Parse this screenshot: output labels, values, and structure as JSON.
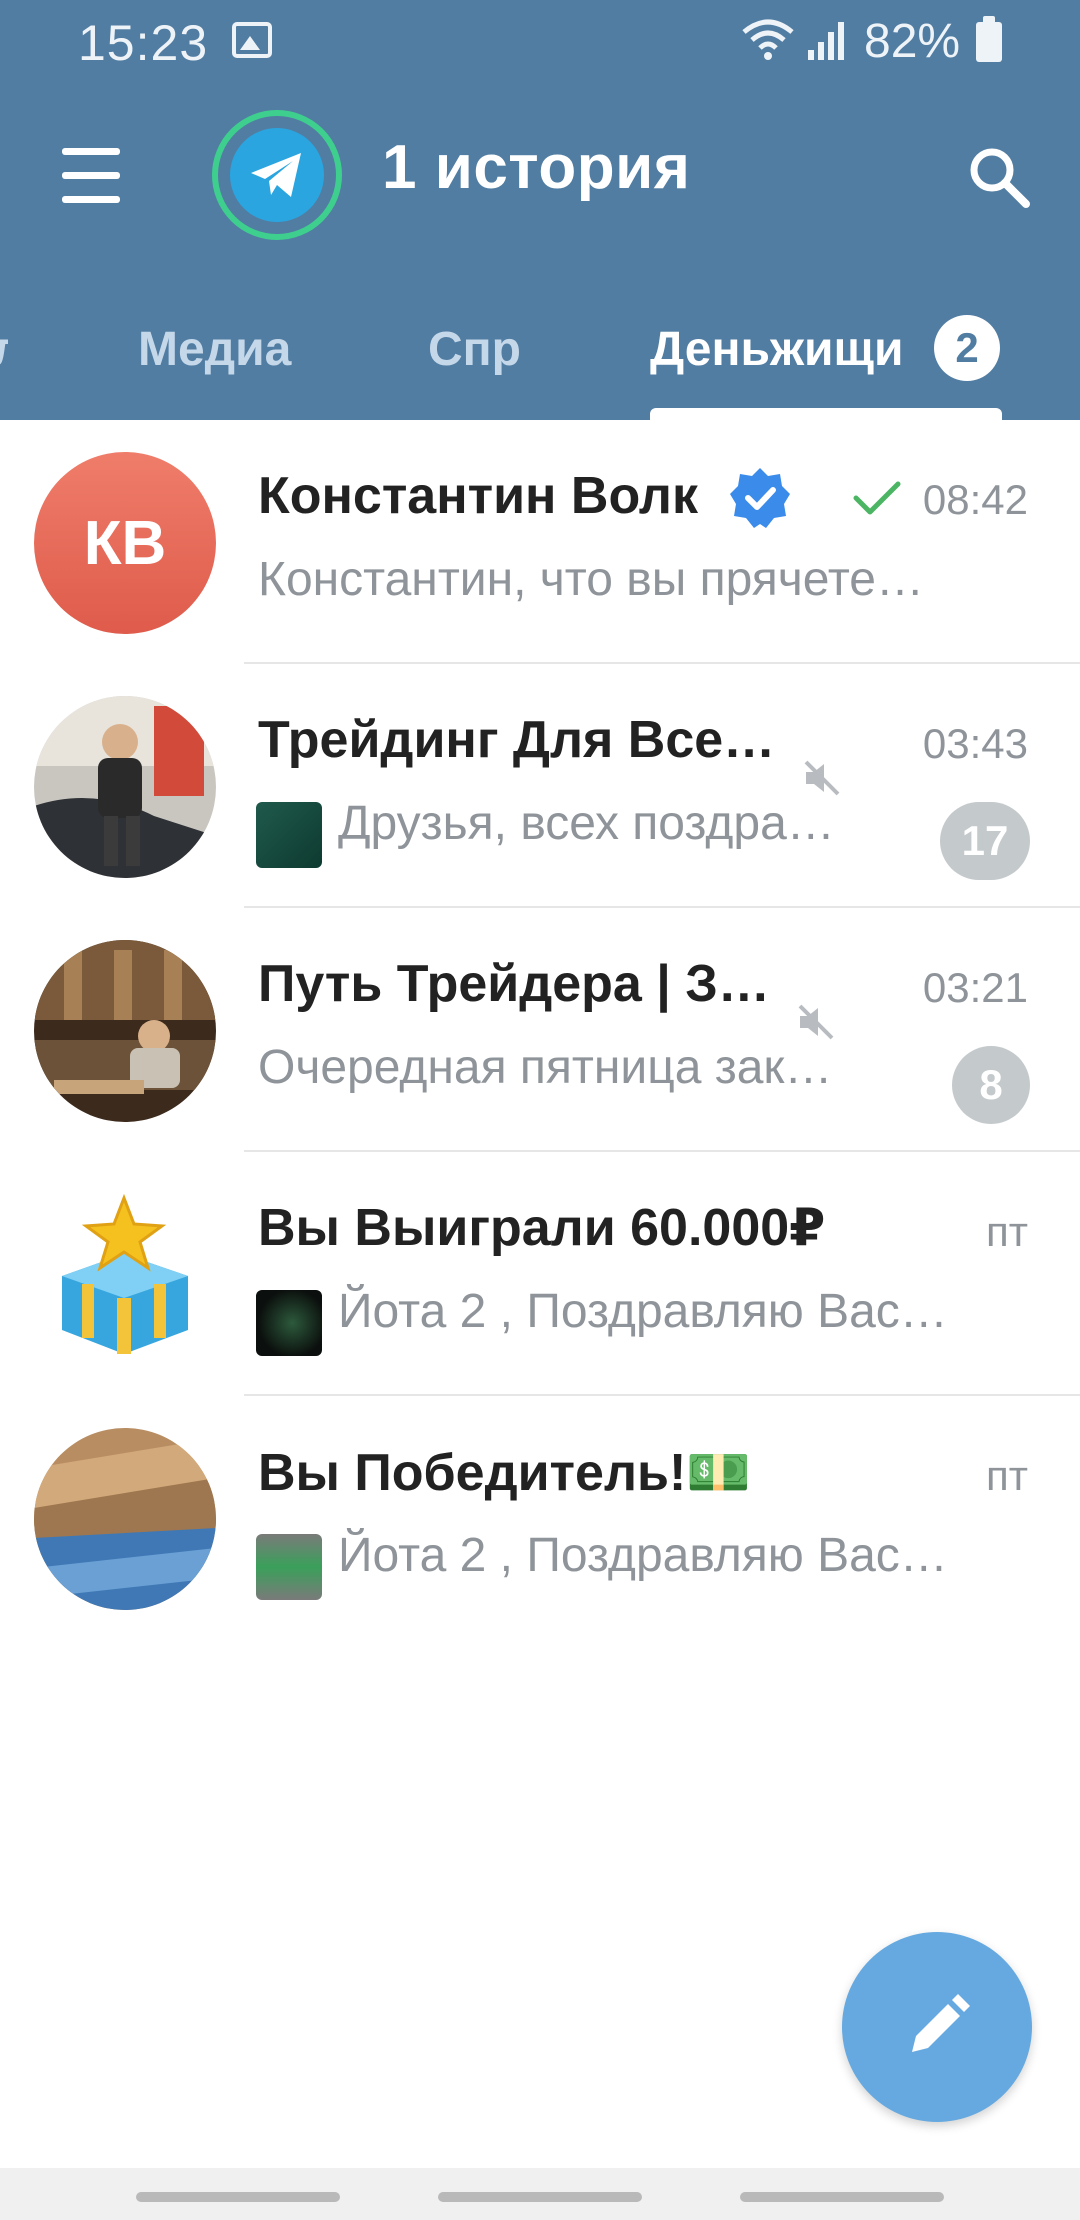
{
  "status_bar": {
    "time": "15:23",
    "battery": "82%"
  },
  "header": {
    "title": "1 история"
  },
  "tabs": [
    {
      "label": "Медиа"
    },
    {
      "label": "Спр"
    },
    {
      "label": "Деньжищи",
      "badge": "2"
    }
  ],
  "chats": [
    {
      "avatar_initials": "КВ",
      "name": "Константин Волк",
      "time": "08:42",
      "preview": "Константин, что вы прячете…",
      "verified": true,
      "read_check": true
    },
    {
      "name": "Трейдинг Для Все…",
      "time": "03:43",
      "preview": "Друзья, всех поздра…",
      "unread": "17",
      "muted": true
    },
    {
      "name": "Путь Трейдера | З…",
      "time": "03:21",
      "preview": "Очередная пятница зак…",
      "unread": "8",
      "muted": true
    },
    {
      "name": "Вы Выиграли 60.000₽",
      "time": "пт",
      "preview": "Йота 2 , Поздравляю Вас…"
    },
    {
      "name": "Вы Победитель!💵",
      "time": "пт",
      "preview": "Йота 2 , Поздравляю Вас…"
    }
  ],
  "colors": {
    "header": "#517da2",
    "fab": "#65a9e0",
    "unread_badge": "#c4c9cc",
    "verified": "#3a8bea"
  }
}
